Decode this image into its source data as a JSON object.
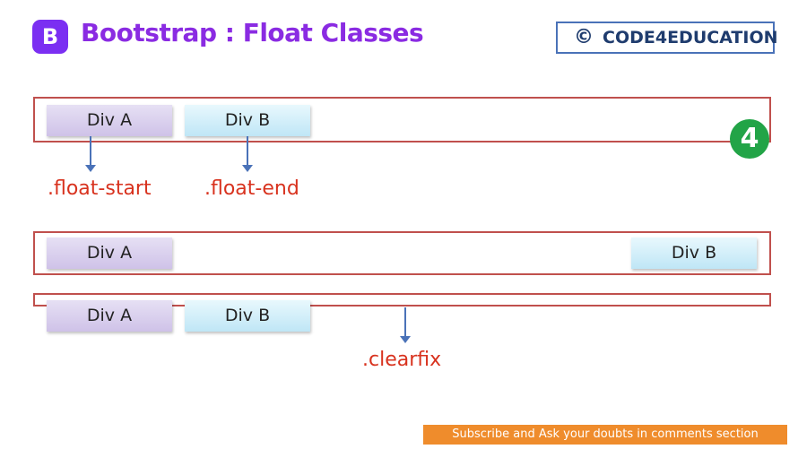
{
  "header": {
    "logo_letter": "B",
    "title": "Bootstrap : Float Classes",
    "copyright_symbol": "©",
    "brand": "CODE4EDUCATION"
  },
  "diagram": {
    "row1": {
      "div_a": "Div A",
      "div_b": "Div B"
    },
    "row2": {
      "div_a": "Div A",
      "div_b": "Div B"
    },
    "row3": {
      "div_a": "Div A",
      "div_b": "Div B"
    },
    "labels": {
      "float_start": ".float-start",
      "float_end": ".float-end",
      "clearfix": ".clearfix"
    }
  },
  "badge": {
    "text": "4"
  },
  "footer": {
    "subscribe": "Subscribe and Ask your doubts in comments section"
  },
  "colors": {
    "accent": "#8a2be2",
    "container_border": "#c0504d",
    "arrow": "#4a72b8",
    "label": "#d8321e",
    "banner": "#ef8c2c"
  }
}
